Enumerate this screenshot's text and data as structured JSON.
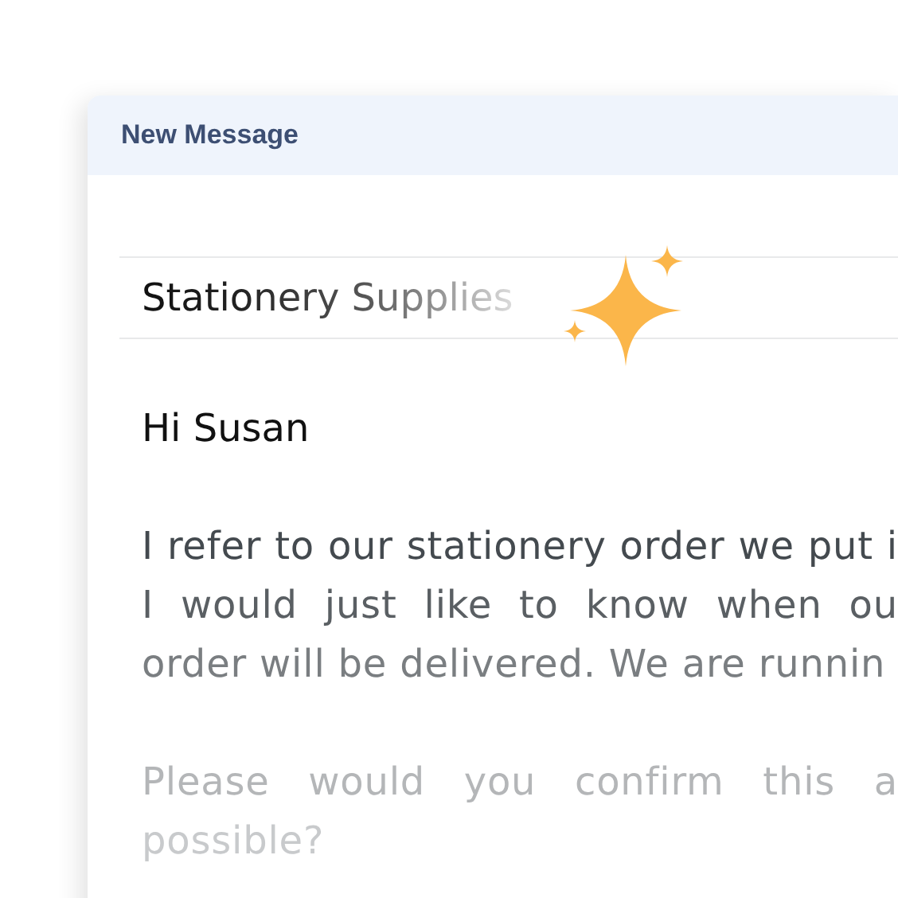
{
  "window": {
    "title": "New Message"
  },
  "subject": {
    "value": "Stationery Supplies"
  },
  "greeting": "Hi Susan",
  "paragraphs": [
    {
      "lines": [
        "I refer to our stationery order we put i",
        "I would just like to know when ou",
        "order will be delivered. We are runnin"
      ]
    },
    {
      "lines": [
        "Please would you confirm this a",
        "possible?"
      ]
    }
  ]
}
